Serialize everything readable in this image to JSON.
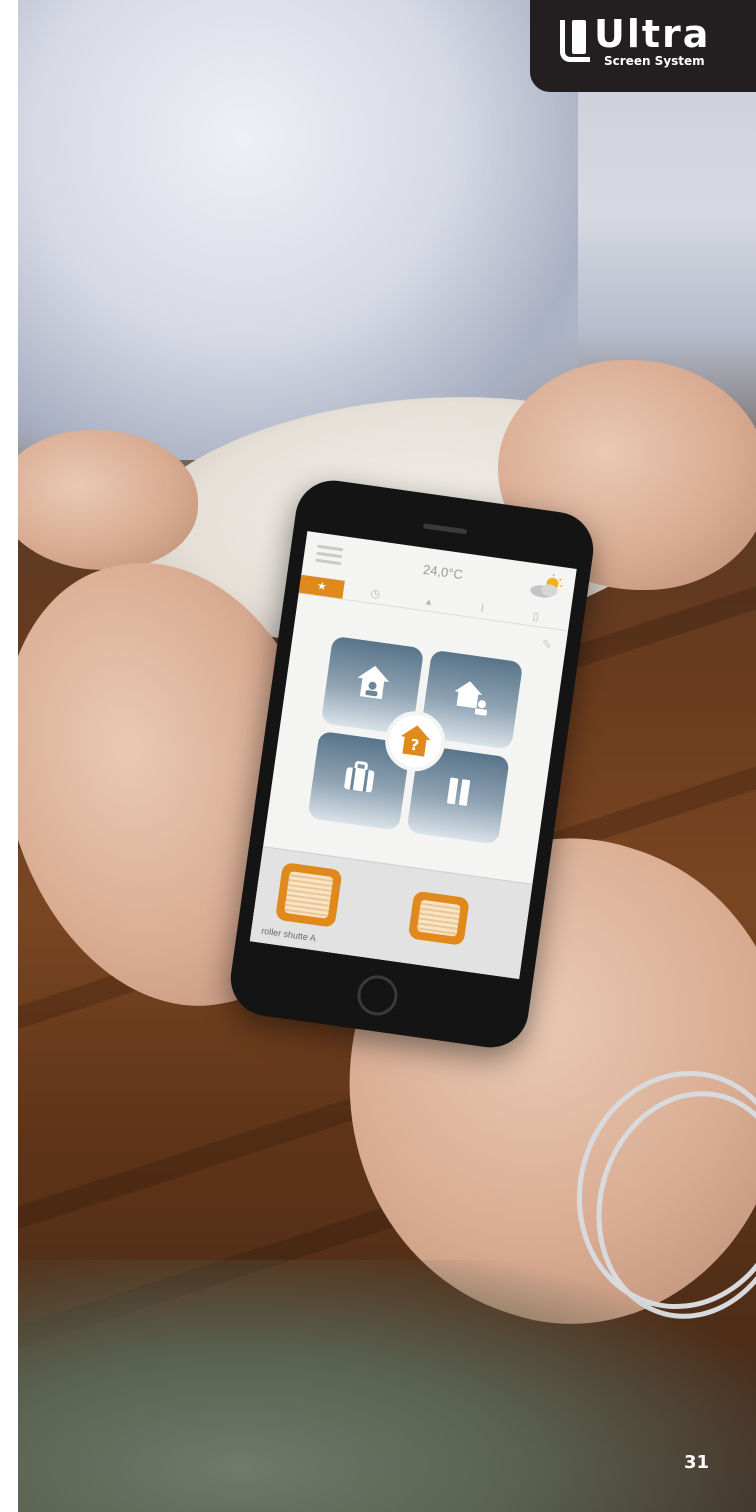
{
  "brand": {
    "title": "Ultra",
    "subtitle": "Screen System",
    "logo_background": "#231f20"
  },
  "app_screen": {
    "temperature": "24,0°C",
    "weather_icon": "sun-cloud-icon",
    "tabs": [
      {
        "icon": "star-icon",
        "active": true
      },
      {
        "icon": "clock-icon",
        "active": false
      },
      {
        "icon": "sensor-icon",
        "active": false
      },
      {
        "icon": "thermometer-icon",
        "active": false
      },
      {
        "icon": "device-icon",
        "active": false
      }
    ],
    "accent_color": "#e08a1e",
    "scenes": [
      {
        "icon": "home-person-icon"
      },
      {
        "icon": "home-away-icon"
      },
      {
        "icon": "luggage-icon"
      },
      {
        "icon": "pause-icon"
      }
    ],
    "center_badge_label": "?",
    "shutter_label": "roller shutte A"
  },
  "page": {
    "number": "31"
  }
}
